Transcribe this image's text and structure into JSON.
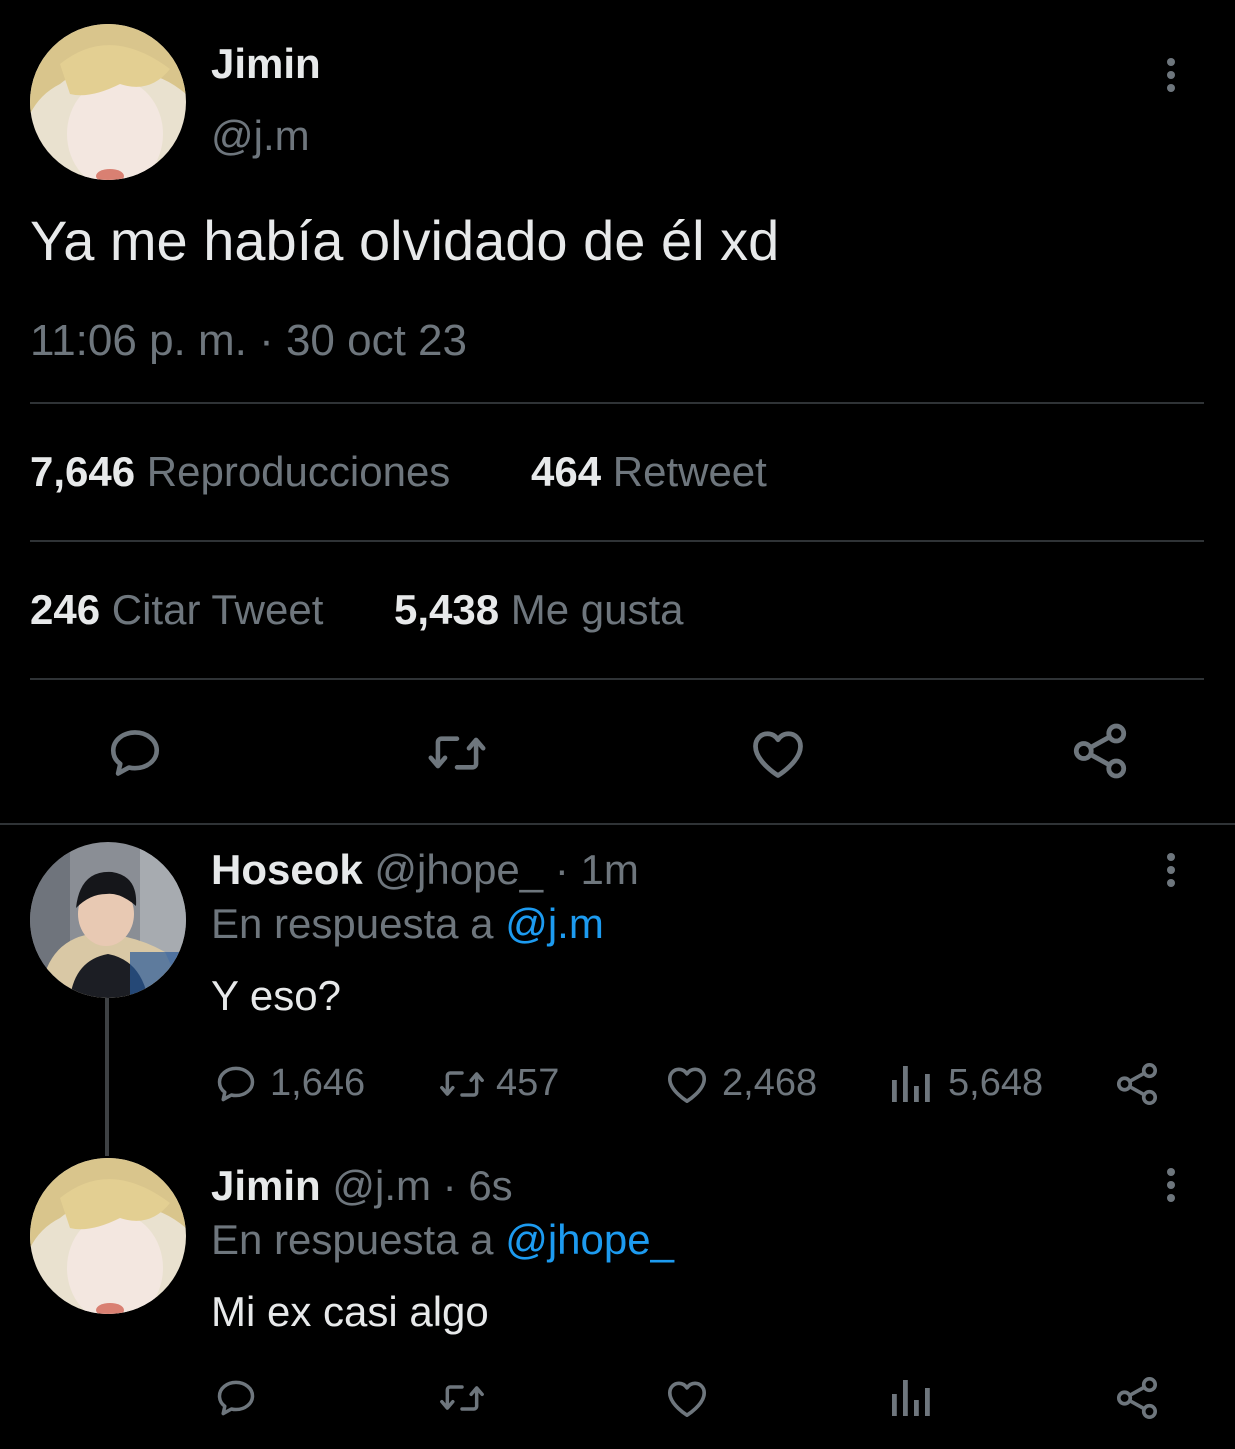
{
  "main_tweet": {
    "display_name": "Jimin",
    "handle": "@j.m",
    "text": "Ya me había olvidado de él xd",
    "timestamp": "11:06 p. m. · 30 oct 23",
    "stats": {
      "views_count": "7,646",
      "views_label": "Reproducciones",
      "retweets_count": "464",
      "retweets_label": "Retweet",
      "quotes_count": "246",
      "quotes_label": "Citar Tweet",
      "likes_count": "5,438",
      "likes_label": "Me gusta"
    }
  },
  "replies": [
    {
      "display_name": "Hoseok",
      "handle_time": "@jhope_ · 1m",
      "reply_prefix": "En respuesta a",
      "reply_to": "@j.m",
      "text": "Y eso?",
      "replies": "1,646",
      "retweets": "457",
      "likes": "2,468",
      "views": "5,648"
    },
    {
      "display_name": "Jimin",
      "handle_time": "@j.m · 6s",
      "reply_prefix": "En respuesta a",
      "reply_to": "@jhope_",
      "text": "Mi ex casi algo"
    }
  ],
  "colors": {
    "background": "#000000",
    "text": "#e7e9ea",
    "muted": "#6e767d",
    "link": "#1d9bf0",
    "divider": "#2f3336"
  },
  "icons": [
    "reply-icon",
    "retweet-icon",
    "like-icon",
    "share-icon",
    "views-icon",
    "more-options-icon"
  ]
}
